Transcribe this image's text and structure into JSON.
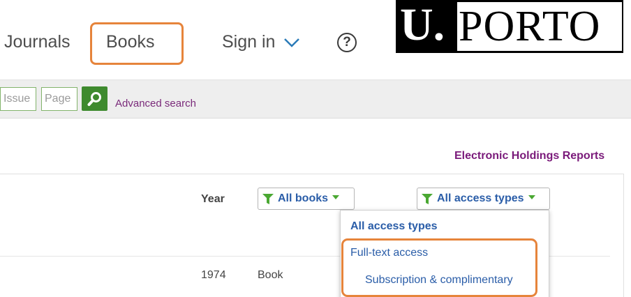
{
  "nav": {
    "journals": "Journals",
    "books": "Books",
    "sign_in": "Sign in",
    "help_glyph": "?"
  },
  "logo": {
    "u_text": "U.",
    "porto_text": "PORTO"
  },
  "search": {
    "issue_placeholder": "Issue",
    "page_placeholder": "Page",
    "advanced_label": "Advanced search"
  },
  "holdings_link": "Electronic Holdings Reports",
  "table": {
    "year_header": "Year",
    "filter_books_label": "All books",
    "filter_access_label": "All access types",
    "rows": [
      {
        "year": "1974",
        "type": "Book"
      }
    ]
  },
  "dropdown": {
    "items": [
      "All access types",
      "Full-text access",
      "Subscription & complimentary"
    ]
  },
  "colors": {
    "highlight": "#e6843b",
    "link_blue": "#2a5da8",
    "link_purple": "#7a1a7a",
    "search_green": "#3e8a2e"
  }
}
